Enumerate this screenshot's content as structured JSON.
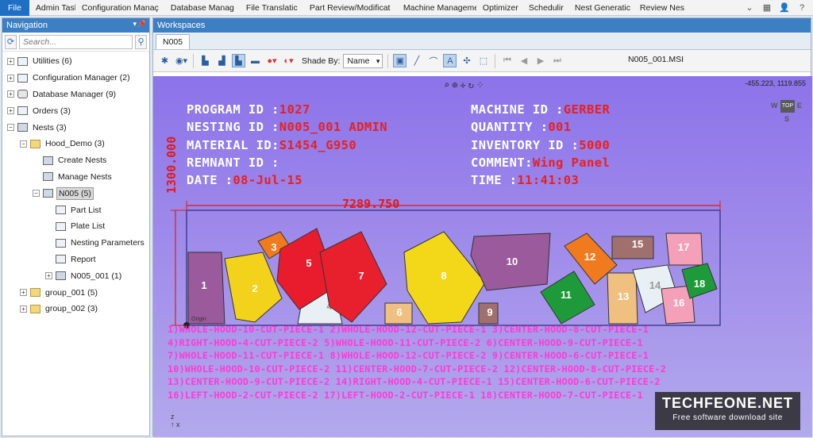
{
  "menubar": {
    "items": [
      "File",
      "Admin Tasl",
      "Configuration Manaç",
      "Database Manag",
      "File Translatic",
      "Part Review/Modificat",
      "Machine Manageme",
      "Optimizer",
      "Schedulir",
      "Nest Generatic",
      "Review Nes"
    ],
    "active_index": 0,
    "accent": "#1f6fc5"
  },
  "navigation": {
    "title": "Navigation",
    "search_placeholder": "Search...",
    "tree": [
      {
        "label": "Utilities (6)",
        "level": 0,
        "exp": "+",
        "icon": "utilities-icon"
      },
      {
        "label": "Configuration Manager (2)",
        "level": 0,
        "exp": "+",
        "icon": "config-icon"
      },
      {
        "label": "Database Manager (9)",
        "level": 0,
        "exp": "+",
        "icon": "database-icon"
      },
      {
        "label": "Orders (3)",
        "level": 0,
        "exp": "+",
        "icon": "orders-icon"
      },
      {
        "label": "Nests (3)",
        "level": 0,
        "exp": "-",
        "icon": "nests-icon"
      },
      {
        "label": "Hood_Demo (3)",
        "level": 1,
        "exp": "-",
        "icon": "folder-icon"
      },
      {
        "label": "Create Nests",
        "level": 2,
        "exp": "",
        "icon": "create-nests-icon"
      },
      {
        "label": "Manage Nests",
        "level": 2,
        "exp": "",
        "icon": "manage-nests-icon"
      },
      {
        "label": "N005 (5)",
        "level": 2,
        "exp": "-",
        "icon": "nest-icon",
        "selected": true
      },
      {
        "label": "Part List",
        "level": 3,
        "exp": "",
        "icon": "part-list-icon"
      },
      {
        "label": "Plate List",
        "level": 3,
        "exp": "",
        "icon": "plate-list-icon"
      },
      {
        "label": "Nesting Parameters",
        "level": 3,
        "exp": "",
        "icon": "parameters-icon"
      },
      {
        "label": "Report",
        "level": 3,
        "exp": "",
        "icon": "report-icon"
      },
      {
        "label": "N005_001 (1)",
        "level": 3,
        "exp": "+",
        "icon": "nest-sheet-icon"
      },
      {
        "label": "group_001 (5)",
        "level": 1,
        "exp": "+",
        "icon": "folder-icon"
      },
      {
        "label": "group_002 (3)",
        "level": 1,
        "exp": "+",
        "icon": "folder-icon"
      }
    ]
  },
  "workspace": {
    "title": "Workspaces",
    "tab": "N005",
    "shade_by_label": "Shade By:",
    "shade_by_value": "Name",
    "file_name": "N005_001.MSI",
    "coords": "-455.223, 1119.855"
  },
  "nest": {
    "header_left": [
      {
        "label": "PROGRAM ID :",
        "value": "1027"
      },
      {
        "label": "NESTING ID :",
        "value": "N005_001 ADMIN"
      },
      {
        "label": "MATERIAL ID:",
        "value": "S1454_G950"
      },
      {
        "label": "REMNANT ID :",
        "value": ""
      },
      {
        "label": "DATE       :",
        "value": "08-Jul-15"
      }
    ],
    "header_right": [
      {
        "label": "MACHINE ID   :",
        "value": "GERBER"
      },
      {
        "label": "QUANTITY     :",
        "value": "001"
      },
      {
        "label": "INVENTORY ID :",
        "value": "5000"
      },
      {
        "label": "COMMENT:",
        "value": "Wing Panel"
      },
      {
        "label": "TIME         :",
        "value": "11:41:03"
      }
    ],
    "plate_width": "7289.750",
    "plate_height": "1300.000",
    "origin_label": "Origin",
    "colors": {
      "header": "#ffffff",
      "value": "#e82020",
      "legend": "#ff3ad4",
      "dimension": "#e01a1a"
    },
    "legend": [
      "1)WHOLE-HOOD-10-CUT-PIECE-1  2)WHOLE-HOOD-12-CUT-PIECE-1  3)CENTER-HOOD-8-CUT-PIECE-1",
      "4)RIGHT-HOOD-4-CUT-PIECE-2  5)WHOLE-HOOD-11-CUT-PIECE-2  6)CENTER-HOOD-9-CUT-PIECE-1",
      "7)WHOLE-HOOD-11-CUT-PIECE-1  8)WHOLE-HOOD-12-CUT-PIECE-2  9)CENTER-HOOD-6-CUT-PIECE-1",
      "10)WHOLE-HOOD-10-CUT-PIECE-2  11)CENTER-HOOD-7-CUT-PIECE-2  12)CENTER-HOOD-8-CUT-PIECE-2",
      "13)CENTER-HOOD-9-CUT-PIECE-2  14)RIGHT-HOOD-4-CUT-PIECE-1  15)CENTER-HOOD-6-CUT-PIECE-2",
      "16)LEFT-HOOD-2-CUT-PIECE-2  17)LEFT-HOOD-2-CUT-PIECE-1  18)CENTER-HOOD-7-CUT-PIECE-1"
    ],
    "pieces": [
      {
        "id": "1",
        "color": "#9b5a9c"
      },
      {
        "id": "2",
        "color": "#f2d21a"
      },
      {
        "id": "3",
        "color": "#f07a1e"
      },
      {
        "id": "4",
        "color": "#e8f0f6"
      },
      {
        "id": "5",
        "color": "#e91c2d"
      },
      {
        "id": "6",
        "color": "#f0c080"
      },
      {
        "id": "7",
        "color": "#e8202e"
      },
      {
        "id": "8",
        "color": "#f3d81a"
      },
      {
        "id": "9",
        "color": "#a0706e"
      },
      {
        "id": "10",
        "color": "#9b5a9c"
      },
      {
        "id": "11",
        "color": "#1e9a3a"
      },
      {
        "id": "12",
        "color": "#f07a1e"
      },
      {
        "id": "13",
        "color": "#f0c080"
      },
      {
        "id": "14",
        "color": "#e8f0f6"
      },
      {
        "id": "15",
        "color": "#a0706e"
      },
      {
        "id": "16",
        "color": "#f4a0b8"
      },
      {
        "id": "17",
        "color": "#f4a0b8"
      },
      {
        "id": "18",
        "color": "#1e9a3a"
      }
    ]
  },
  "watermark": {
    "title": "TECHFEONE.NET",
    "subtitle": "Free software download site"
  }
}
